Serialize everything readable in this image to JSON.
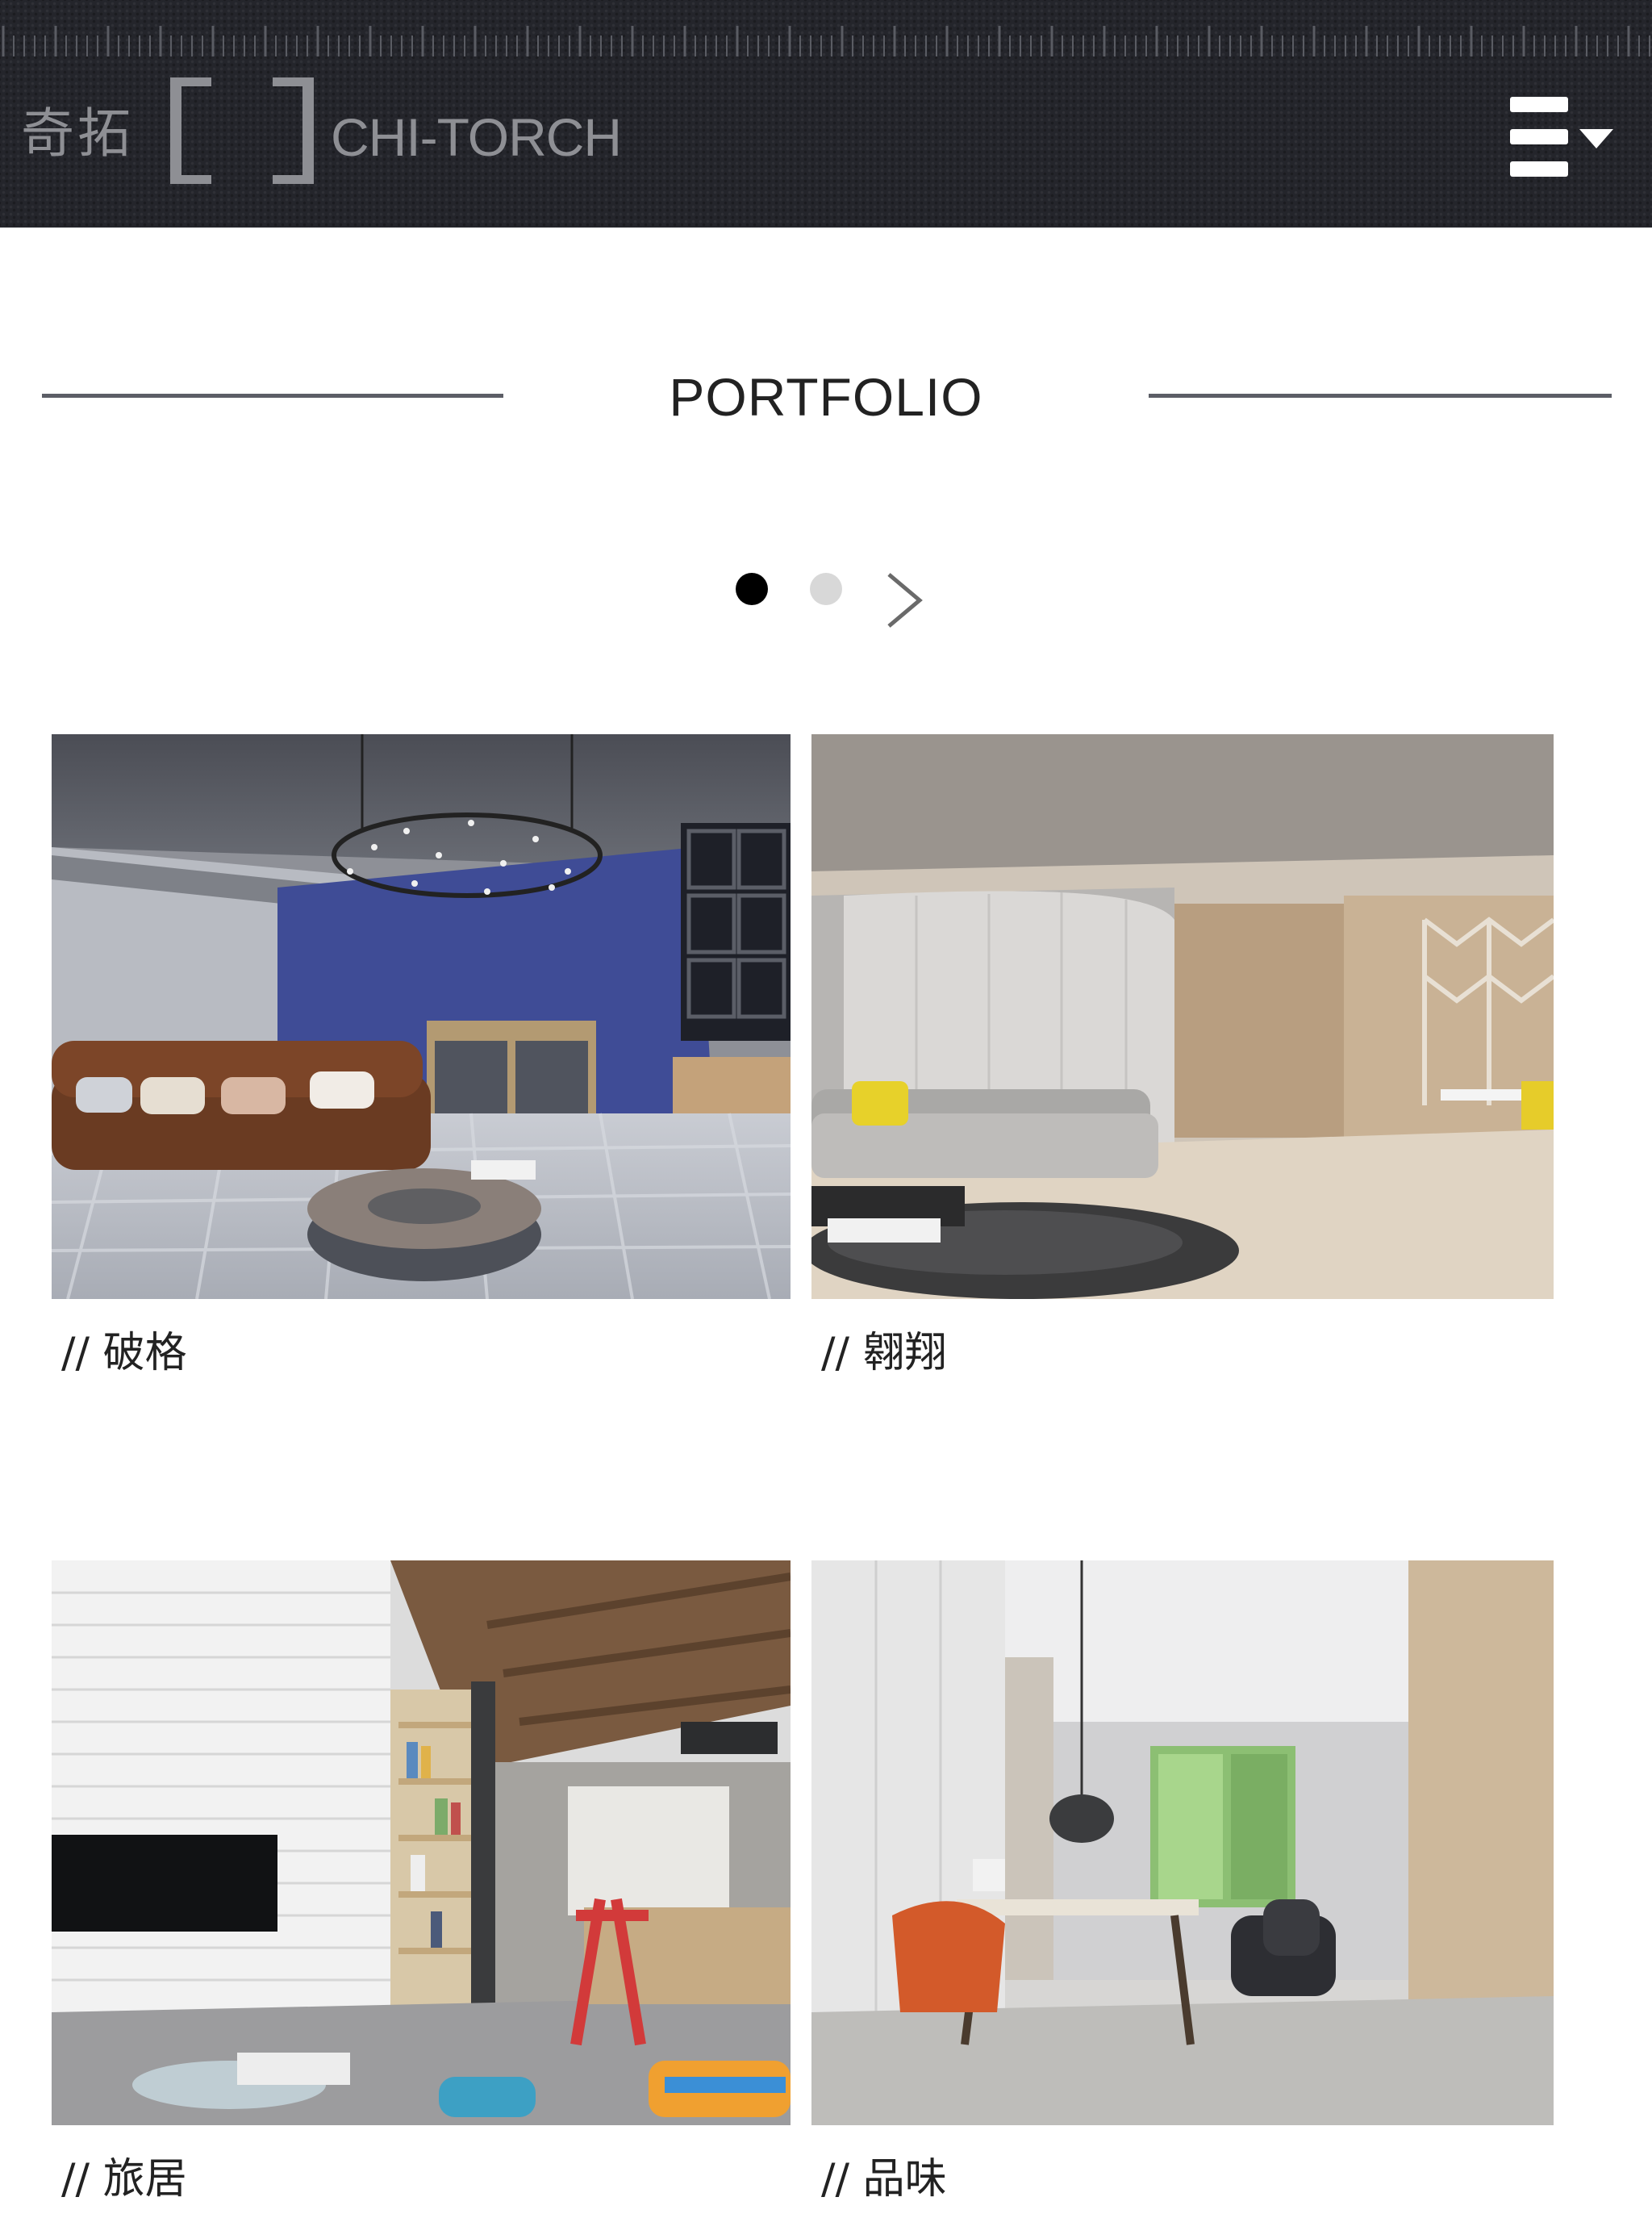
{
  "header": {
    "logo_cn": "奇拓",
    "logo_en": "CHI-TORCH",
    "background_color": "#24252b",
    "menu_icon": "hamburger-menu-icon"
  },
  "section": {
    "title": "PORTFOLIO"
  },
  "pager": {
    "pages": 2,
    "active_page": 1,
    "next_icon": "chevron-right-icon"
  },
  "portfolio": {
    "items": [
      {
        "caption": "// 破格"
      },
      {
        "caption": "// 翱翔"
      },
      {
        "caption": "// 旅居"
      },
      {
        "caption": "// 品味"
      }
    ]
  }
}
